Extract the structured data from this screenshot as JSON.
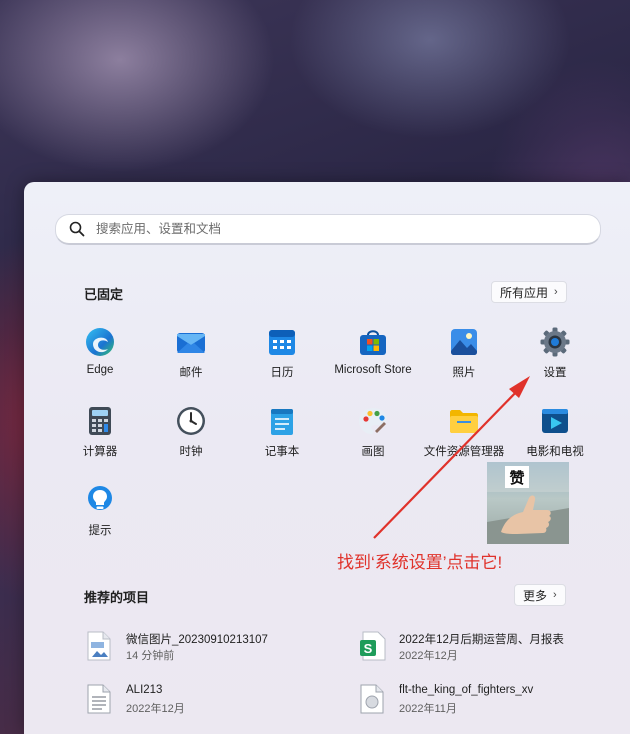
{
  "search": {
    "placeholder": "搜索应用、设置和文档"
  },
  "pinned": {
    "title": "已固定",
    "all_apps_label": "所有应用",
    "apps": [
      {
        "label": "Edge",
        "icon": "edge-icon"
      },
      {
        "label": "邮件",
        "icon": "mail-icon"
      },
      {
        "label": "日历",
        "icon": "calendar-icon"
      },
      {
        "label": "Microsoft Store",
        "icon": "store-icon"
      },
      {
        "label": "照片",
        "icon": "photos-icon"
      },
      {
        "label": "设置",
        "icon": "gear-icon"
      },
      {
        "label": "计算器",
        "icon": "calculator-icon"
      },
      {
        "label": "时钟",
        "icon": "clock-icon"
      },
      {
        "label": "记事本",
        "icon": "notepad-icon"
      },
      {
        "label": "画图",
        "icon": "paint-icon"
      },
      {
        "label": "文件资源管理器",
        "icon": "folder-icon"
      },
      {
        "label": "电影和电视",
        "icon": "movies-icon"
      },
      {
        "label": "提示",
        "icon": "tips-icon"
      }
    ]
  },
  "recommended": {
    "title": "推荐的项目",
    "more_label": "更多",
    "items": [
      {
        "name": "微信图片_20230910213107",
        "time": "14 分钟前",
        "icon": "jpg-file-icon"
      },
      {
        "name": "2022年12月后期运营周、月报表",
        "time": "2022年12月",
        "icon": "spreadsheet-file-icon"
      },
      {
        "name": "ALI213",
        "time": "2022年12月",
        "icon": "text-file-icon"
      },
      {
        "name": "flt-the_king_of_fighters_xv",
        "time": "2022年11月",
        "icon": "generic-file-icon"
      }
    ]
  },
  "annotation": {
    "text": "找到‘系统设置’点击它!",
    "color": "#e0322b"
  },
  "sticker": {
    "text": "赞"
  }
}
